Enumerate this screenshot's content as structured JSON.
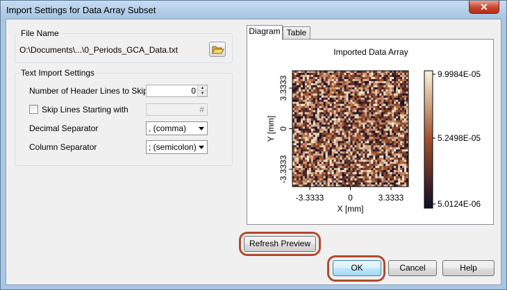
{
  "window": {
    "title": "Import Settings for Data Array Subset",
    "close_label": "✕"
  },
  "file_group": {
    "label": "File Name",
    "path": "O:\\Documents\\...\\0_Periods_GCA_Data.txt"
  },
  "import_group": {
    "label": "Text Import Settings",
    "header_lines_label": "Number of Header Lines to Skip",
    "header_lines_value": "0",
    "skip_lines_label": "Skip Lines Starting with",
    "skip_lines_value": "#",
    "skip_lines_checked": false,
    "decimal_label": "Decimal Separator",
    "decimal_value": ", (comma)",
    "column_label": "Column Separator",
    "column_value": "; (semicolon)"
  },
  "tabs": [
    {
      "label": "Diagram",
      "active": true
    },
    {
      "label": "Table",
      "active": false
    }
  ],
  "diagram": {
    "title": "Imported Data Array",
    "y_label": "Y [mm]",
    "x_label": "X [mm]",
    "x_ticks": [
      "-3.3333",
      "0",
      "3.3333"
    ],
    "y_ticks": [
      "3.3333",
      "0",
      "-3.3333"
    ],
    "colorbar_ticks": [
      "9.9984E-05",
      "5.2498E-05",
      "5.0124E-06"
    ],
    "colors": {
      "low": "#100c28",
      "mid": "#a0502a",
      "high": "#fcf3da"
    }
  },
  "buttons": {
    "refresh": "Refresh Preview",
    "ok": "OK",
    "cancel": "Cancel",
    "help": "Help"
  }
}
